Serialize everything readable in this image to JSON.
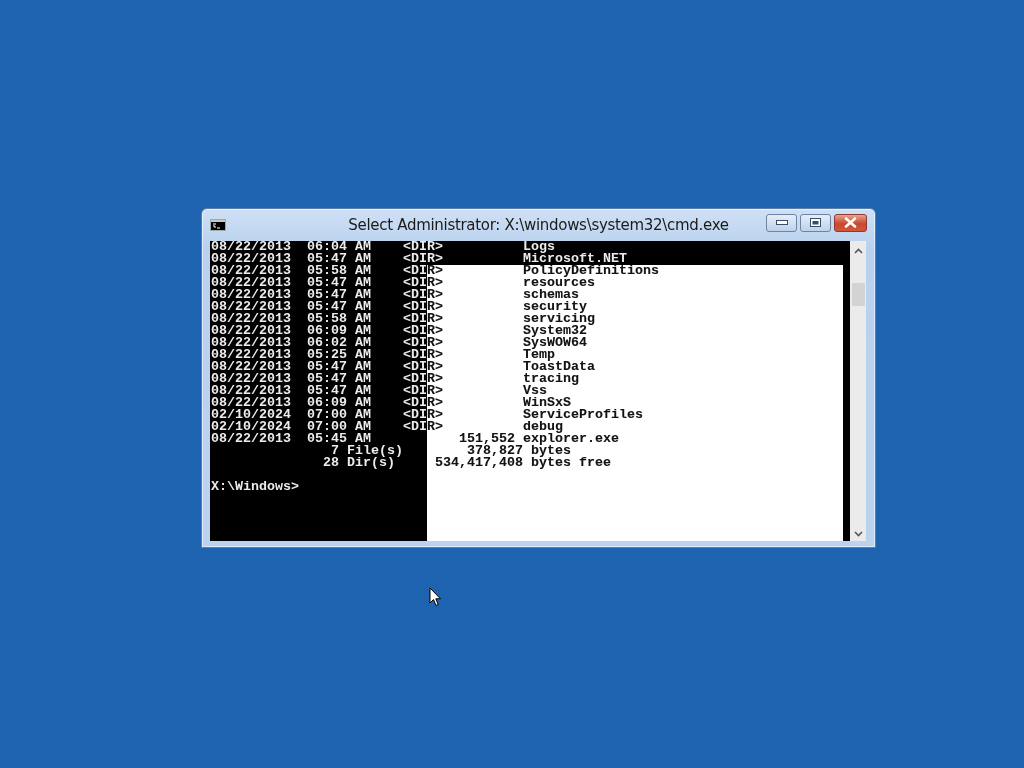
{
  "window": {
    "title": "Select Administrator: X:\\windows\\system32\\cmd.exe"
  },
  "console": {
    "lines": [
      {
        "kind": "entry",
        "text": "08/22/2013  06:04 AM    <DIR>          Logs",
        "selected": false
      },
      {
        "kind": "entry",
        "text": "08/22/2013  05:47 AM    <DIR>          Microsoft.NET",
        "selected": false
      },
      {
        "kind": "entry",
        "text": "08/22/2013  05:58 AM    <DIR>          PolicyDefinitions",
        "selected": true
      },
      {
        "kind": "entry",
        "text": "08/22/2013  05:47 AM    <DIR>          resources",
        "selected": true
      },
      {
        "kind": "entry",
        "text": "08/22/2013  05:47 AM    <DIR>          schemas",
        "selected": true
      },
      {
        "kind": "entry",
        "text": "08/22/2013  05:47 AM    <DIR>          security",
        "selected": true
      },
      {
        "kind": "entry",
        "text": "08/22/2013  05:58 AM    <DIR>          servicing",
        "selected": true
      },
      {
        "kind": "entry",
        "text": "08/22/2013  06:09 AM    <DIR>          System32",
        "selected": true
      },
      {
        "kind": "entry",
        "text": "08/22/2013  06:02 AM    <DIR>          SysWOW64",
        "selected": true
      },
      {
        "kind": "entry",
        "text": "08/22/2013  05:25 AM    <DIR>          Temp",
        "selected": true
      },
      {
        "kind": "entry",
        "text": "08/22/2013  05:47 AM    <DIR>          ToastData",
        "selected": true
      },
      {
        "kind": "entry",
        "text": "08/22/2013  05:47 AM    <DIR>          tracing",
        "selected": true
      },
      {
        "kind": "entry",
        "text": "08/22/2013  05:47 AM    <DIR>          Vss",
        "selected": true
      },
      {
        "kind": "entry",
        "text": "08/22/2013  06:09 AM    <DIR>          WinSxS",
        "selected": true
      },
      {
        "kind": "entry",
        "text": "02/10/2024  07:00 AM    <DIR>          ServiceProfiles",
        "selected": true
      },
      {
        "kind": "entry",
        "text": "02/10/2024  07:00 AM    <DIR>          debug",
        "selected": true
      },
      {
        "kind": "entry",
        "text": "08/22/2013  05:45 AM           151,552 explorer.exe",
        "selected": true
      },
      {
        "kind": "summary",
        "text": "               7 File(s)        378,827 bytes",
        "selected": true
      },
      {
        "kind": "summary",
        "text": "              28 Dir(s)     534,417,408 bytes free",
        "selected": true
      },
      {
        "kind": "prompt",
        "text": "X:\\Windows>",
        "selected": true
      }
    ]
  }
}
